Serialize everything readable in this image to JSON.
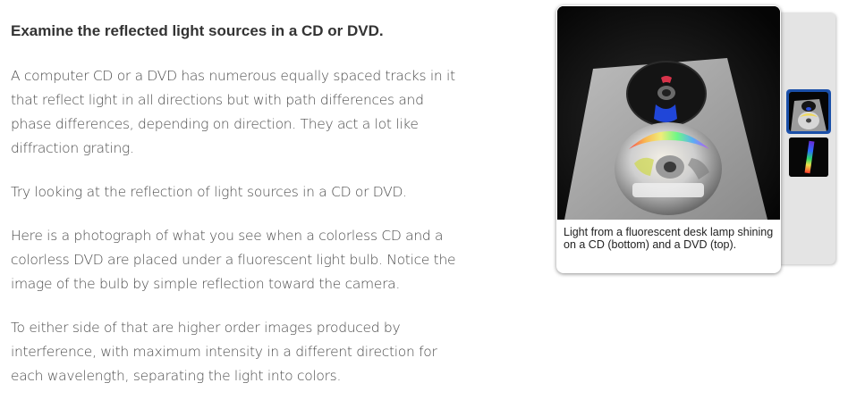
{
  "article": {
    "heading": "Examine the reflected light sources in a CD or DVD.",
    "paragraphs": [
      "A computer CD or a DVD has numerous equally spaced tracks in it that reflect light in all directions but with path differences and phase differences, depending on direction. They act a lot like diffraction grating.",
      "Try looking at the reflection of light sources in a CD or DVD.",
      "Here is a photograph of what you see when a colorless CD and a colorless DVD are placed under a fluorescent light bulb. Notice the image of the bulb by simple reflection toward the camera.",
      "To either side of that are higher order images produced by interference, with maximum intensity in a different direction for each wavelength, separating the light into colors."
    ]
  },
  "gallery": {
    "caption": "Light from a fluorescent desk lamp shining on a CD (bottom) and a DVD (top).",
    "selected_index": 0,
    "thumbnails": [
      "cd-dvd-photo-thumbnail",
      "spectrum-photo-thumbnail"
    ],
    "accent_color": "#2b5db8"
  }
}
